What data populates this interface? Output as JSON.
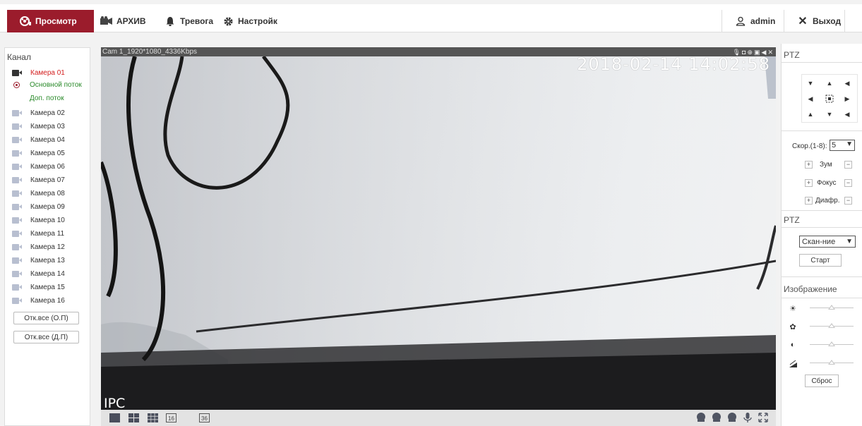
{
  "nav": {
    "live": "Просмотр",
    "archive": "АРХИВ",
    "alarm": "Тревога",
    "settings": "Настройк",
    "user": "admin",
    "logout": "Выход",
    "accent": "#9b1c2c"
  },
  "channels": {
    "title": "Канал",
    "active_camera": "Камера 01",
    "main_stream": "Основной поток",
    "sub_stream": "Доп. поток",
    "cameras": [
      "Камера 02",
      "Камера 03",
      "Камера 04",
      "Камера 05",
      "Камера 06",
      "Камера 07",
      "Камера 08",
      "Камера 09",
      "Камера 10",
      "Камера 11",
      "Камера 12",
      "Камера 13",
      "Камера 14",
      "Камера 15",
      "Камера 16"
    ],
    "open_all_main": "Отк.все (О.П)",
    "open_all_sub": "Отк.все (Д.П)"
  },
  "video": {
    "header": "Cam 1_1920*1080_4336Kbps",
    "timestamp": "2018-02-14 14:02:58",
    "watermark": "IPC"
  },
  "ptz": {
    "title": "PTZ",
    "speed_label": "Скор.(1-8):",
    "speed_value": "5",
    "zoom": "Зум",
    "focus": "Фокус",
    "iris": "Диафр.",
    "plus": "+",
    "minus": "−"
  },
  "ptz2": {
    "title": "PTZ",
    "mode": "Скан-ние",
    "start": "Старт"
  },
  "image": {
    "title": "Изображение",
    "brightness": "64",
    "saturation": "64",
    "contrast": "64",
    "sharpness": "64",
    "level": 0.5,
    "reset": "Сброс"
  }
}
